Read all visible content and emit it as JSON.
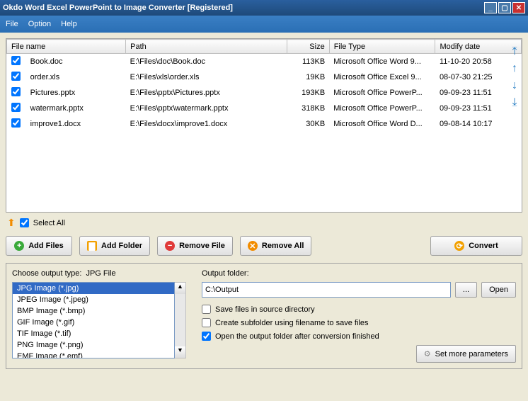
{
  "window": {
    "title": "Okdo Word Excel PowerPoint to Image Converter [Registered]"
  },
  "menu": {
    "file": "File",
    "option": "Option",
    "help": "Help"
  },
  "table": {
    "headers": {
      "name": "File name",
      "path": "Path",
      "size": "Size",
      "type": "File Type",
      "date": "Modify date"
    },
    "rows": [
      {
        "name": "Book.doc",
        "path": "E:\\Files\\doc\\Book.doc",
        "size": "113KB",
        "type": "Microsoft Office Word 9...",
        "date": "11-10-20 20:58"
      },
      {
        "name": "order.xls",
        "path": "E:\\Files\\xls\\order.xls",
        "size": "19KB",
        "type": "Microsoft Office Excel 9...",
        "date": "08-07-30 21:25"
      },
      {
        "name": "Pictures.pptx",
        "path": "E:\\Files\\pptx\\Pictures.pptx",
        "size": "193KB",
        "type": "Microsoft Office PowerP...",
        "date": "09-09-23 11:51"
      },
      {
        "name": "watermark.pptx",
        "path": "E:\\Files\\pptx\\watermark.pptx",
        "size": "318KB",
        "type": "Microsoft Office PowerP...",
        "date": "09-09-23 11:51"
      },
      {
        "name": "improve1.docx",
        "path": "E:\\Files\\docx\\improve1.docx",
        "size": "30KB",
        "type": "Microsoft Office Word D...",
        "date": "09-08-14 10:17"
      }
    ]
  },
  "selectall": {
    "label": "Select All"
  },
  "buttons": {
    "addfiles": "Add Files",
    "addfolder": "Add Folder",
    "removefile": "Remove File",
    "removeall": "Remove All",
    "convert": "Convert"
  },
  "output_type": {
    "label": "Choose output type:",
    "value_label": "JPG File",
    "options": [
      "JPG Image (*.jpg)",
      "JPEG Image (*.jpeg)",
      "BMP Image (*.bmp)",
      "GIF Image (*.gif)",
      "TIF Image (*.tif)",
      "PNG Image (*.png)",
      "EMF Image (*.emf)"
    ],
    "selected_index": 0
  },
  "output_folder": {
    "label": "Output folder:",
    "value": "C:\\Output",
    "browse": "...",
    "open": "Open"
  },
  "checks": {
    "save_source": "Save files in source directory",
    "create_sub": "Create subfolder using filename to save files",
    "open_after": "Open the output folder after conversion finished"
  },
  "more": {
    "label": "Set more parameters"
  }
}
